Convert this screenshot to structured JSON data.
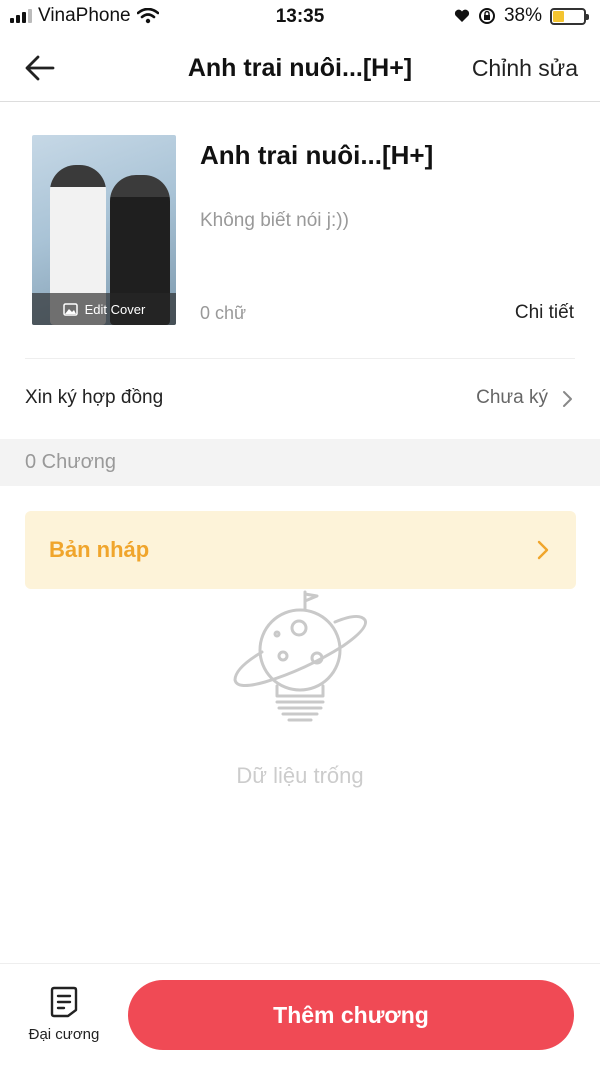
{
  "status_bar": {
    "carrier": "VinaPhone",
    "time": "13:35",
    "battery": "38%",
    "battery_level": 0.38
  },
  "header": {
    "title": "Anh trai nuôi...[H+]",
    "edit_label": "Chỉnh sửa",
    "back_icon": "arrow-left-icon"
  },
  "book": {
    "title": "Anh trai nuôi...[H+]",
    "description": "Không biết nói j:))",
    "word_count": "0 chữ",
    "detail_label": "Chi tiết",
    "cover_edit_label": "Edit Cover"
  },
  "contract": {
    "label": "Xin ký hợp đồng",
    "status": "Chưa ký"
  },
  "chapters": {
    "count_label": "0 Chương"
  },
  "draft": {
    "label": "Bản nháp",
    "color": "#f0a52c",
    "background": "#fdf3d9"
  },
  "empty_state": {
    "text": "Dữ liệu trống",
    "icon": "lightbulb-planet-icon"
  },
  "bottom_bar": {
    "outline_label": "Đại cương",
    "add_chapter_label": "Thêm chương",
    "accent_color": "#f04a55"
  }
}
